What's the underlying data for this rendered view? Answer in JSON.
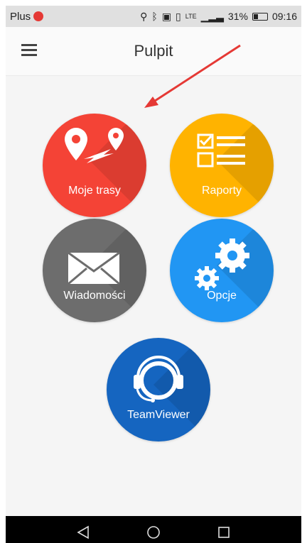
{
  "status_bar": {
    "carrier": "Plus",
    "battery": "31%",
    "time": "09:16",
    "network": "LTE"
  },
  "app_bar": {
    "title": "Pulpit",
    "menu_icon": "hamburger-menu-icon"
  },
  "tiles": [
    {
      "label": "Moje trasy",
      "color": "#f44336",
      "icon": "route-pins-icon"
    },
    {
      "label": "Raporty",
      "color": "#ffb300",
      "icon": "checklist-icon"
    },
    {
      "label": "Wiadomości",
      "color": "#6d6d6d",
      "icon": "envelope-icon"
    },
    {
      "label": "Opcje",
      "color": "#2196f3",
      "icon": "gears-icon"
    },
    {
      "label": "TeamViewer",
      "color": "#1565c0",
      "icon": "headset-icon"
    }
  ],
  "annotation": {
    "color": "#e53935",
    "icon": "red-arrow"
  },
  "nav_bar": {
    "back_icon": "back-triangle-icon",
    "home_icon": "home-circle-icon",
    "recents_icon": "recents-square-icon"
  }
}
